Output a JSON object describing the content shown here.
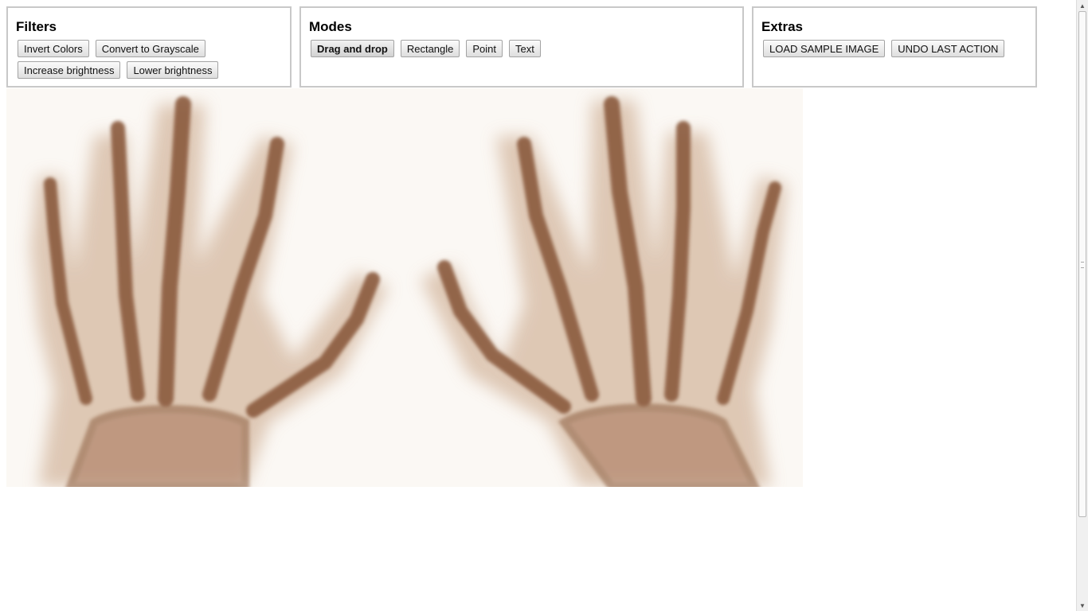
{
  "filters": {
    "legend": "Filters",
    "buttons": [
      "Invert Colors",
      "Convert to Grayscale",
      "Increase brightness",
      "Lower brightness"
    ]
  },
  "modes": {
    "legend": "Modes",
    "buttons": [
      "Drag and drop",
      "Rectangle",
      "Point",
      "Text"
    ],
    "active": "Drag and drop"
  },
  "extras": {
    "legend": "Extras",
    "buttons": [
      "LOAD SAMPLE IMAGE",
      "UNDO LAST ACTION"
    ]
  },
  "image": {
    "subject": "x-ray of two hands",
    "tint_bg": "#fbf8f4",
    "tint_shadow": "#c9a98f",
    "tint_bone": "#8a5a3c"
  }
}
